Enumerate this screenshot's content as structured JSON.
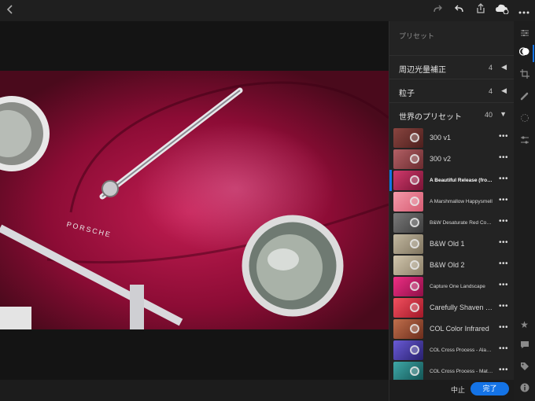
{
  "topbar": {
    "icons": [
      "back-icon",
      "redo-icon",
      "undo-icon",
      "share-icon",
      "cloud-icon",
      "more-icon"
    ]
  },
  "panel": {
    "title": "プリセット",
    "sections": [
      {
        "label": "周辺光量補正",
        "count": "4",
        "state": "collapsed"
      },
      {
        "label": "粒子",
        "count": "4",
        "state": "collapsed"
      },
      {
        "label": "世界のプリセット",
        "count": "40",
        "state": "expanded"
      }
    ],
    "presets": [
      {
        "label": "300 v1",
        "tint": "#7a3a34"
      },
      {
        "label": "300 v2",
        "tint": "#9b4a4e"
      },
      {
        "label": "A Beautiful Release (from J...",
        "tint": "#b82a5a"
      },
      {
        "label": "A Marshmallow Happysmell",
        "tint": "#ec7f92"
      },
      {
        "label": "B&W Desaturate Red Contr...",
        "tint": "#5d5d5d"
      },
      {
        "label": "B&W Old 1",
        "tint": "#a69c86"
      },
      {
        "label": "B&W Old 2",
        "tint": "#b5aa93"
      },
      {
        "label": "Capture One Landscape",
        "tint": "#d41f6f"
      },
      {
        "label": "Carefully Shaven Turk",
        "tint": "#e23447"
      },
      {
        "label": "COL Color Infrared",
        "tint": "#a3563a"
      },
      {
        "label": "COL Cross Process - Alan's...",
        "tint": "#4b3eb0"
      },
      {
        "label": "COL Cross Process - Matrix...",
        "tint": "#2f8a8a"
      }
    ],
    "more_glyph": "•••",
    "cancel_label": "中止",
    "done_label": "完了"
  },
  "rail": {
    "icons": [
      "sliders-icon",
      "presets-icon",
      "crop-icon",
      "brush-icon",
      "selective-icon",
      "adjust-icon",
      "star-icon",
      "comment-icon",
      "tag-icon",
      "info-icon"
    ]
  },
  "photo": {
    "badge": "PORSCHE"
  },
  "colors": {
    "accent": "#1473e6",
    "panel_bg": "#232323",
    "canvas_bg": "#141414"
  }
}
